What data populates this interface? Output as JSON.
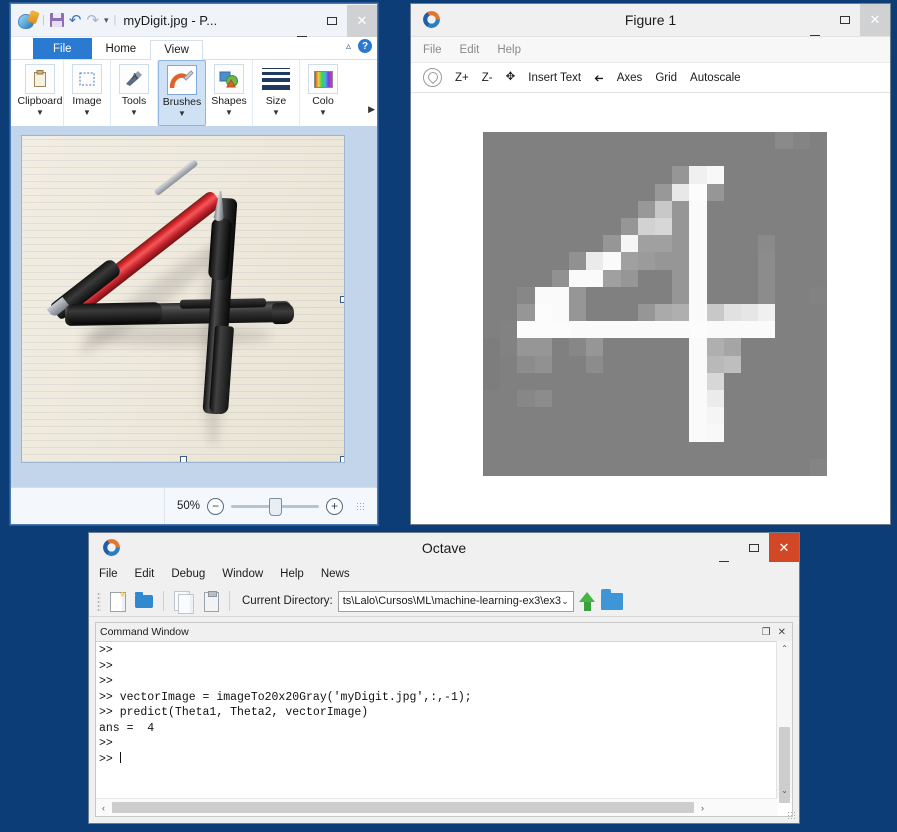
{
  "desktop": {
    "background": "#0c3d77"
  },
  "paint": {
    "title": "myDigit.jpg - P...",
    "logo_icon": "paint-logo-icon",
    "quick_access": [
      {
        "name": "save-icon",
        "label": "Save"
      },
      {
        "name": "undo-icon",
        "label": "Undo"
      },
      {
        "name": "redo-icon",
        "label": "Redo"
      },
      {
        "name": "customize-qat-icon",
        "label": "▾"
      }
    ],
    "window_buttons": {
      "minimize": "─",
      "maximize": "☐",
      "close": "✕"
    },
    "tabs": [
      {
        "label": "File",
        "state": "file"
      },
      {
        "label": "Home",
        "state": "active"
      },
      {
        "label": "View",
        "state": "normal"
      }
    ],
    "ribbon_collapse_icon": "chevron-up-icon",
    "help_icon": "help-question-icon",
    "ribbon_groups": [
      {
        "label": "Clipboard",
        "icon": "clipboard-icon",
        "caret": "▼",
        "selected": false
      },
      {
        "label": "Image",
        "icon": "select-rectangle-icon",
        "caret": "▼",
        "selected": false
      },
      {
        "label": "Tools",
        "icon": "tools-pencil-icon",
        "caret": "▼",
        "selected": false
      },
      {
        "label": "Brushes",
        "icon": "brush-icon",
        "caret": "▼",
        "selected": true
      },
      {
        "label": "Shapes",
        "icon": "shapes-icon",
        "caret": "▼",
        "selected": false
      },
      {
        "label": "Size",
        "icon": "size-lines-icon",
        "caret": "▼",
        "selected": false
      },
      {
        "label": "Colo",
        "icon": "colors-palette-icon",
        "caret": "▼",
        "selected": false
      }
    ],
    "ribbon_overflow_icon": "overflow-arrow-icon",
    "canvas": {
      "image_name": "pens-forming-digit-four-photo",
      "description": "Photo of three pens arranged as the digit 4 on lined paper"
    },
    "status": {
      "zoom_level": "50%",
      "zoom_out_icon": "−",
      "zoom_in_icon": "+",
      "resize_grip_icon": "resize-grip-icon"
    }
  },
  "figure": {
    "title": "Figure 1",
    "logo_icon": "octave-logo-icon",
    "window_buttons": {
      "minimize": "─",
      "maximize": "☐",
      "close": "✕"
    },
    "menu": [
      "File",
      "Edit",
      "Help"
    ],
    "toolbar": [
      {
        "name": "rotate-tool-icon",
        "label": ""
      },
      {
        "name": "zoom-in-button",
        "label": "Z+"
      },
      {
        "name": "zoom-out-button",
        "label": "Z-"
      },
      {
        "name": "pan-tool-icon",
        "label": "✥"
      },
      {
        "name": "insert-text-button",
        "label": "Insert Text"
      },
      {
        "name": "select-cursor-icon",
        "label": ""
      },
      {
        "name": "axes-button",
        "label": "Axes"
      },
      {
        "name": "grid-button",
        "label": "Grid"
      },
      {
        "name": "autoscale-button",
        "label": "Autoscale"
      }
    ],
    "plot": {
      "name": "digit-20x20-grayscale-image",
      "background": "#ffffff"
    }
  },
  "chart_data": {
    "type": "heatmap",
    "title": "Figure 1",
    "description": "20x20 grayscale image of handwritten digit 4 rendered by Octave imagesc",
    "xlabel": "",
    "ylabel": "",
    "grid": false,
    "legend": "none",
    "colormap": "gray",
    "background_gray": 128,
    "rows": 20,
    "cols": 20,
    "value_range": [
      0,
      255
    ],
    "values": [
      [
        128,
        128,
        128,
        128,
        128,
        128,
        128,
        128,
        128,
        128,
        128,
        128,
        128,
        128,
        128,
        128,
        128,
        138,
        132,
        128
      ],
      [
        128,
        128,
        128,
        128,
        128,
        128,
        128,
        128,
        128,
        128,
        128,
        128,
        128,
        128,
        128,
        128,
        128,
        128,
        128,
        128
      ],
      [
        128,
        128,
        128,
        128,
        128,
        128,
        128,
        128,
        128,
        128,
        128,
        150,
        240,
        248,
        128,
        128,
        128,
        128,
        128,
        128
      ],
      [
        128,
        128,
        128,
        128,
        128,
        128,
        128,
        128,
        128,
        128,
        152,
        232,
        252,
        150,
        128,
        128,
        128,
        128,
        128,
        128
      ],
      [
        128,
        128,
        128,
        128,
        128,
        128,
        128,
        128,
        128,
        152,
        200,
        150,
        250,
        128,
        128,
        128,
        128,
        128,
        128,
        128
      ],
      [
        128,
        128,
        128,
        128,
        128,
        128,
        128,
        128,
        150,
        210,
        215,
        150,
        250,
        128,
        128,
        128,
        128,
        128,
        128,
        128
      ],
      [
        128,
        128,
        128,
        128,
        128,
        128,
        128,
        150,
        245,
        160,
        160,
        150,
        250,
        128,
        128,
        128,
        138,
        128,
        128,
        128
      ],
      [
        128,
        128,
        128,
        128,
        128,
        145,
        235,
        250,
        160,
        155,
        150,
        150,
        250,
        128,
        128,
        128,
        140,
        128,
        128,
        128
      ],
      [
        128,
        128,
        128,
        128,
        145,
        250,
        250,
        160,
        150,
        128,
        128,
        150,
        250,
        128,
        128,
        128,
        140,
        128,
        128,
        128
      ],
      [
        128,
        128,
        135,
        250,
        250,
        150,
        128,
        128,
        128,
        128,
        128,
        150,
        250,
        128,
        128,
        128,
        140,
        128,
        128,
        130
      ],
      [
        128,
        128,
        150,
        252,
        250,
        150,
        128,
        128,
        128,
        150,
        170,
        175,
        250,
        200,
        225,
        230,
        240,
        128,
        128,
        128
      ],
      [
        128,
        130,
        252,
        252,
        252,
        250,
        250,
        250,
        250,
        250,
        250,
        250,
        252,
        250,
        250,
        250,
        250,
        128,
        128,
        128
      ],
      [
        125,
        130,
        150,
        150,
        128,
        135,
        150,
        128,
        128,
        128,
        128,
        128,
        250,
        175,
        165,
        128,
        128,
        128,
        128,
        128
      ],
      [
        125,
        128,
        140,
        145,
        128,
        128,
        140,
        128,
        128,
        128,
        128,
        128,
        250,
        185,
        190,
        128,
        128,
        128,
        128,
        128
      ],
      [
        125,
        128,
        128,
        128,
        128,
        128,
        128,
        128,
        128,
        128,
        128,
        128,
        250,
        215,
        128,
        128,
        128,
        128,
        128,
        128
      ],
      [
        128,
        128,
        135,
        140,
        128,
        128,
        128,
        128,
        128,
        128,
        128,
        128,
        250,
        235,
        128,
        128,
        128,
        128,
        128,
        128
      ],
      [
        128,
        128,
        128,
        128,
        128,
        128,
        128,
        128,
        128,
        128,
        128,
        128,
        250,
        245,
        128,
        128,
        128,
        128,
        128,
        128
      ],
      [
        128,
        128,
        128,
        128,
        128,
        128,
        128,
        128,
        128,
        128,
        128,
        128,
        250,
        248,
        128,
        128,
        128,
        128,
        128,
        128
      ],
      [
        128,
        128,
        128,
        128,
        128,
        128,
        128,
        128,
        128,
        128,
        128,
        128,
        128,
        128,
        128,
        128,
        128,
        128,
        128,
        128
      ],
      [
        128,
        128,
        128,
        128,
        128,
        128,
        128,
        128,
        128,
        128,
        128,
        128,
        128,
        128,
        128,
        128,
        128,
        128,
        128,
        132
      ]
    ]
  },
  "octave": {
    "title": "Octave",
    "logo_icon": "octave-logo-icon",
    "window_buttons": {
      "minimize": "─",
      "maximize": "☐",
      "close": "✕"
    },
    "close_color": "#d24726",
    "menu": [
      "File",
      "Edit",
      "Debug",
      "Window",
      "Help",
      "News"
    ],
    "toolbar": {
      "new_script_icon": "new-script-icon",
      "open_icon": "open-folder-icon",
      "copy_icon": "copy-icon",
      "paste_icon": "paste-icon",
      "cd_label": "Current Directory:",
      "cd_value": "ts\\Lalo\\Cursos\\ML\\machine-learning-ex3\\ex3",
      "cd_caret": "⌄",
      "up_dir_icon": "up-directory-icon",
      "browse_dir_icon": "browse-directory-icon"
    },
    "command_window": {
      "panel_title": "Command Window",
      "undock_icon": "❐",
      "close_icon": "✕",
      "lines": [
        ">>",
        ">>",
        ">>",
        ">> vectorImage = imageTo20x20Gray('myDigit.jpg',:,-1);",
        ">> predict(Theta1, Theta2, vectorImage)",
        "ans =  4",
        ">>",
        ">> "
      ],
      "prediction_answer": "4",
      "scroll_left_icon": "‹",
      "scroll_right_icon": "›",
      "scroll_up_icon": "⌃",
      "scroll_down_icon": "⌄"
    }
  }
}
